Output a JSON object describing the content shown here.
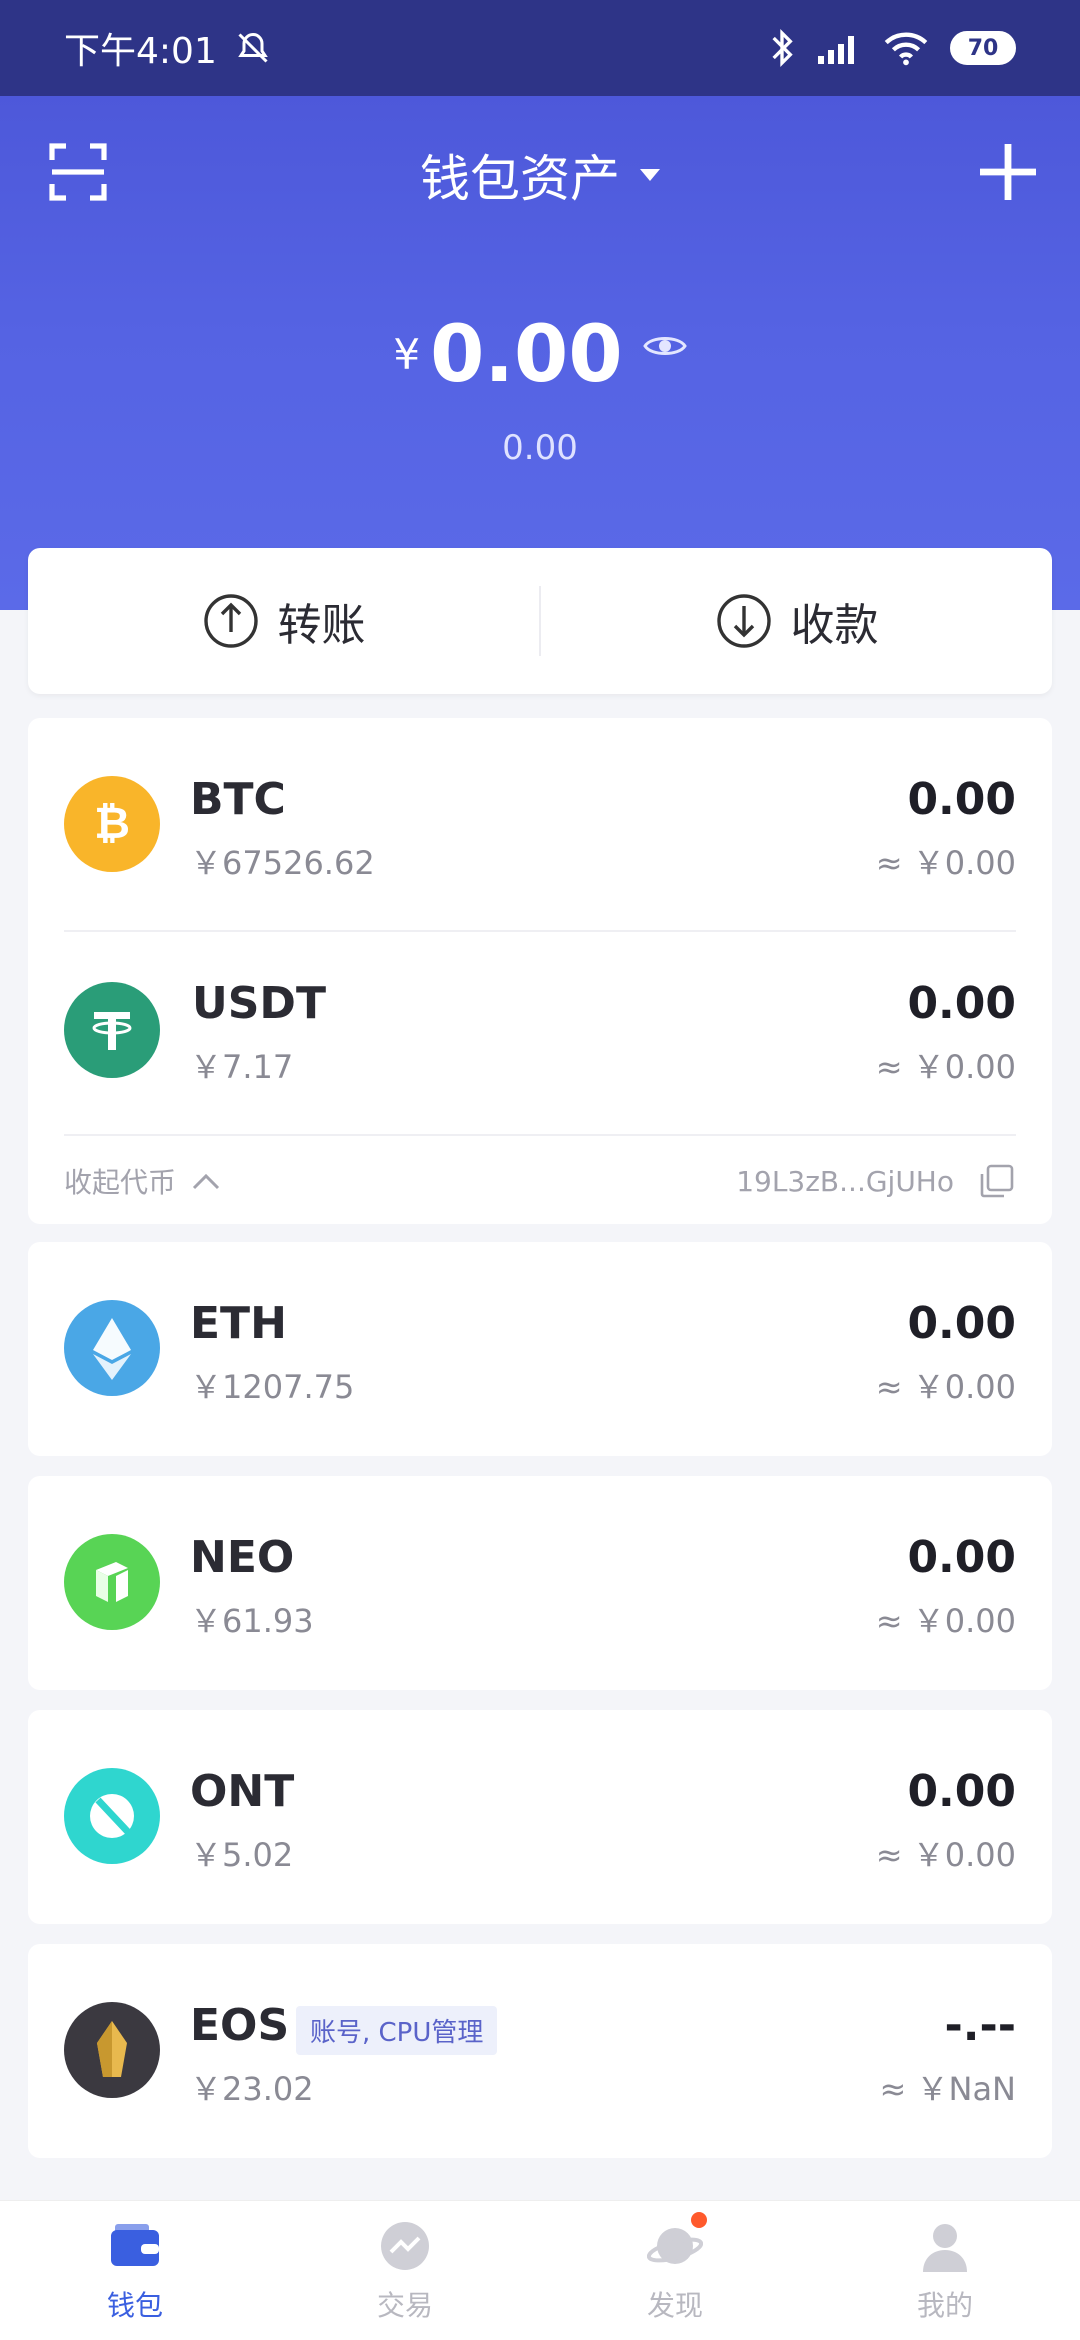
{
  "status": {
    "time": "下午4:01",
    "battery": "70"
  },
  "header": {
    "title": "钱包资产",
    "balance_currency": "¥",
    "balance_value": "0.00",
    "balance_sub": "0.00"
  },
  "actions": {
    "transfer": "转账",
    "receive": "收款"
  },
  "coins": [
    {
      "symbol": "BTC",
      "price": "￥67526.62",
      "amount": "0.00",
      "value": "≈ ￥0.00",
      "color": "#f9b52a",
      "icon": "bitcoin-icon"
    },
    {
      "symbol": "USDT",
      "price": "￥7.17",
      "amount": "0.00",
      "value": "≈ ￥0.00",
      "color": "#2a9d78",
      "icon": "tether-icon"
    },
    {
      "symbol": "ETH",
      "price": "￥1207.75",
      "amount": "0.00",
      "value": "≈ ￥0.00",
      "color": "#4aa7e6",
      "icon": "ethereum-icon"
    },
    {
      "symbol": "NEO",
      "price": "￥61.93",
      "amount": "0.00",
      "value": "≈ ￥0.00",
      "color": "#58d455",
      "icon": "neo-icon"
    },
    {
      "symbol": "ONT",
      "price": "￥5.02",
      "amount": "0.00",
      "value": "≈ ￥0.00",
      "color": "#2fd6cf",
      "icon": "ont-icon"
    },
    {
      "symbol": "EOS",
      "price": "￥23.02",
      "amount": "-.--",
      "value": "≈ ￥NaN",
      "color": "#3b3940",
      "icon": "eos-icon"
    }
  ],
  "btc_group": {
    "collapse_label": "收起代币",
    "address": "19L3zB...GjUHo"
  },
  "eos_badge": "账号, CPU管理",
  "tabs": [
    {
      "label": "钱包",
      "active": true
    },
    {
      "label": "交易",
      "active": false
    },
    {
      "label": "发现",
      "active": false
    },
    {
      "label": "我的",
      "active": false
    }
  ]
}
